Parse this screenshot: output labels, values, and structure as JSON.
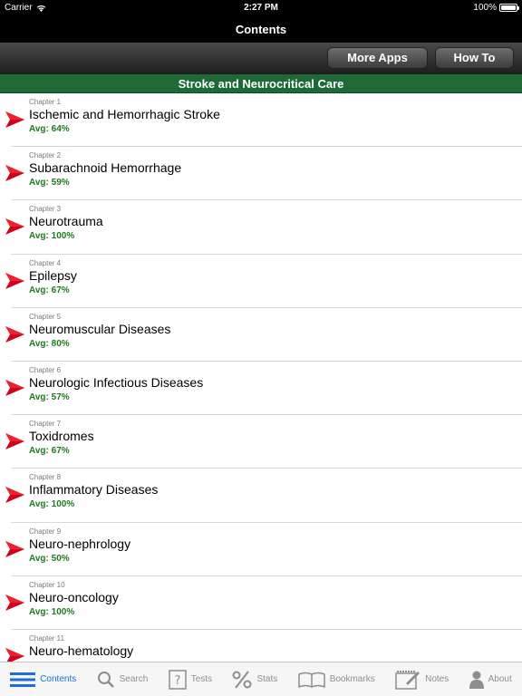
{
  "status": {
    "carrier": "Carrier",
    "time": "2:27 PM",
    "battery": "100%"
  },
  "nav": {
    "title": "Contents"
  },
  "toolbar": {
    "more_apps": "More Apps",
    "how_to": "How To"
  },
  "section": {
    "title": "Stroke and Neurocritical Care"
  },
  "chapters": [
    {
      "chapter": "Chapter 1",
      "title": "Ischemic and Hemorrhagic Stroke",
      "avg": "Avg: 64%"
    },
    {
      "chapter": "Chapter 2",
      "title": "Subarachnoid Hemorrhage",
      "avg": "Avg: 59%"
    },
    {
      "chapter": "Chapter 3",
      "title": "Neurotrauma",
      "avg": "Avg: 100%"
    },
    {
      "chapter": "Chapter 4",
      "title": "Epilepsy",
      "avg": "Avg: 67%"
    },
    {
      "chapter": "Chapter 5",
      "title": "Neuromuscular Diseases",
      "avg": "Avg: 80%"
    },
    {
      "chapter": "Chapter 6",
      "title": "Neurologic Infectious Diseases",
      "avg": "Avg: 57%"
    },
    {
      "chapter": "Chapter 7",
      "title": "Toxidromes",
      "avg": "Avg: 67%"
    },
    {
      "chapter": "Chapter 8",
      "title": "Inflammatory Diseases",
      "avg": "Avg: 100%"
    },
    {
      "chapter": "Chapter 9",
      "title": "Neuro-nephrology",
      "avg": "Avg: 50%"
    },
    {
      "chapter": "Chapter 10",
      "title": "Neuro-oncology",
      "avg": "Avg: 100%"
    },
    {
      "chapter": "Chapter 11",
      "title": "Neuro-hematology",
      "avg": ""
    }
  ],
  "tabs": [
    {
      "label": "Contents",
      "icon": "list-icon",
      "active": true
    },
    {
      "label": "Search",
      "icon": "search-icon",
      "active": false
    },
    {
      "label": "Tests",
      "icon": "question-icon",
      "active": false
    },
    {
      "label": "Stats",
      "icon": "percent-icon",
      "active": false
    },
    {
      "label": "Bookmarks",
      "icon": "book-icon",
      "active": false
    },
    {
      "label": "Notes",
      "icon": "notepad-icon",
      "active": false
    },
    {
      "label": "About",
      "icon": "person-icon",
      "active": false
    }
  ],
  "colors": {
    "accent": "#1d6fd6",
    "section_bg": "#1e6a36",
    "avg_text": "#1f7a1f",
    "arrow": "#d0021b"
  }
}
